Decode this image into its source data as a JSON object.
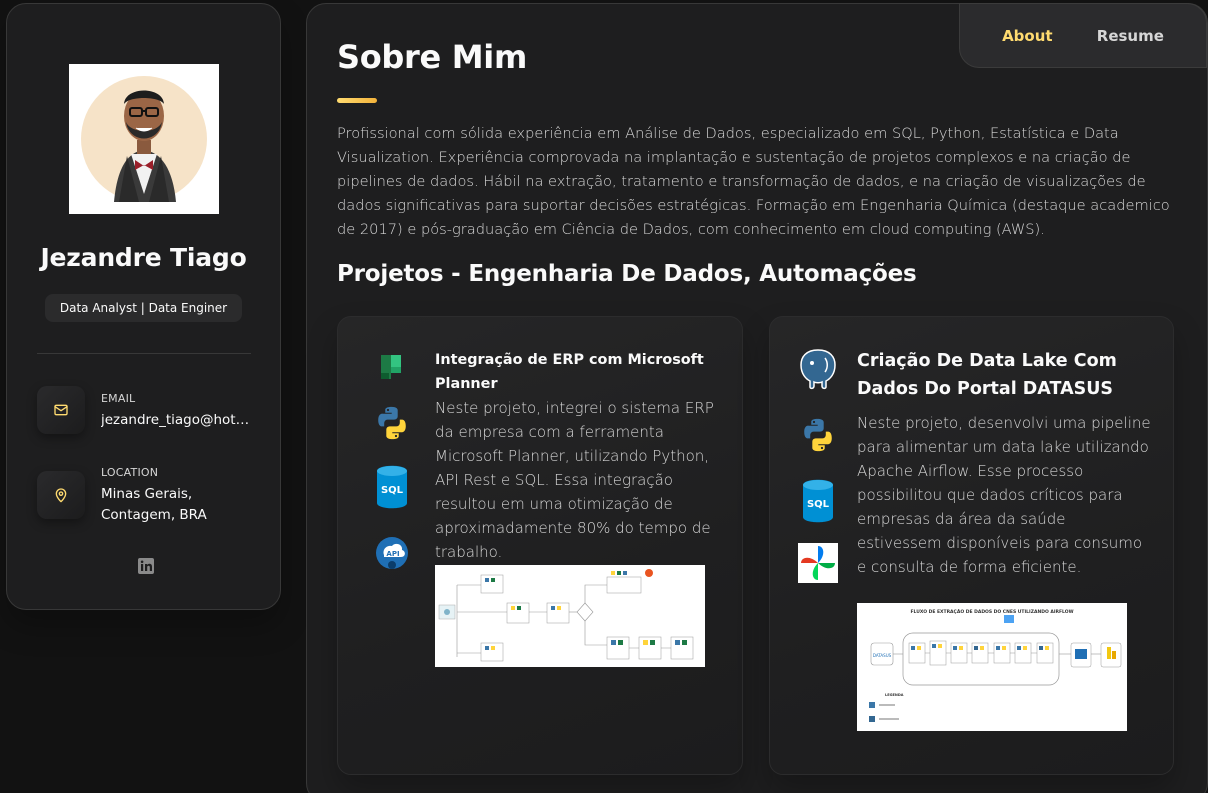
{
  "profile": {
    "name": "Jezandre Tiago",
    "title": "Data Analyst | Data Enginer",
    "email_label": "EMAIL",
    "email_value": "jezandre_tiago@hotmail.com",
    "location_label": "LOCATION",
    "location_value": "Minas Gerais, Contagem, BRA"
  },
  "nav": {
    "about": "About",
    "resume": "Resume"
  },
  "about": {
    "title": "Sobre Mim",
    "text": "Profissional com sólida experiência em Análise de Dados, especializado em SQL, Python, Estatística e Data Visualization. Experiência comprovada na implantação e sustentação de projetos complexos e na criação de pipelines de dados. Hábil na extração, tratamento e transformação de dados, e na criação de visualizações de dados significativas para suportar decisões estratégicas. Formação em Engenharia Química (destaque academico de 2017) e pós-graduação em Ciência de Dados, com conhecimento em cloud computing (AWS)."
  },
  "projects": {
    "section_title": "Projetos - Engenharia De Dados, Automações",
    "items": [
      {
        "title": "Integração de ERP com Microsoft Planner",
        "description": "Neste projeto, integrei o sistema ERP da empresa com a ferramenta Microsoft Planner, utilizando Python, API Rest e SQL. Essa integração resultou em uma otimização de aproximadamente 80% do tempo de trabalho.",
        "icons": [
          "planner-icon",
          "python-icon",
          "sql-icon",
          "api-icon"
        ]
      },
      {
        "title": "Criação De Data Lake Com Dados Do Portal DATASUS",
        "description": "Neste projeto, desenvolvi uma pipeline para alimentar um data lake utilizando Apache Airflow. Esse processo possibilitou que dados críticos para empresas da área da saúde estivessem disponíveis para consumo e consulta de forma eficiente.",
        "icons": [
          "postgresql-icon",
          "python-icon",
          "sql-icon",
          "airflow-icon"
        ],
        "diagram_title": "FLUXO DE EXTRAÇÃO DE DADOS DO CNES UTILIZANDO AIRFLOW",
        "diagram_legend": "LEGENDA"
      }
    ]
  },
  "colors": {
    "accent": "#ffdb70",
    "background": "#121212",
    "card": "#1e1e1f"
  }
}
